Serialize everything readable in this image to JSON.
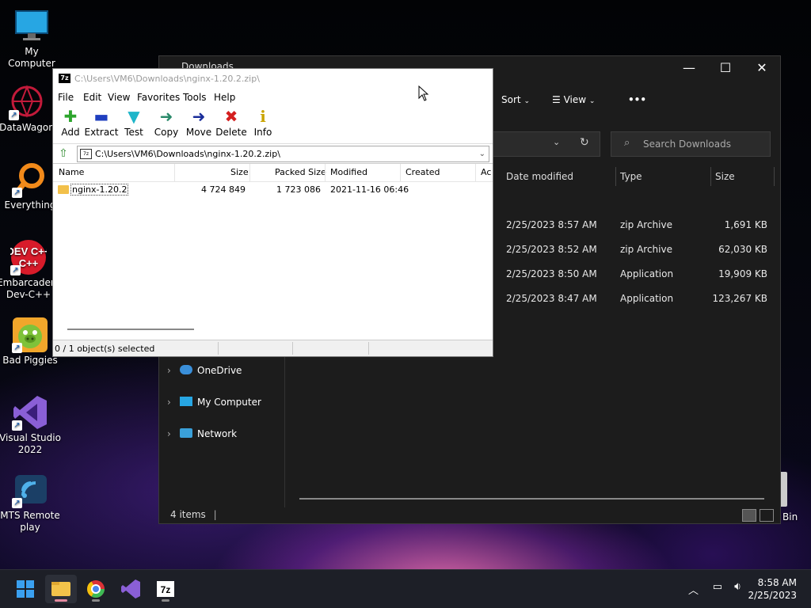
{
  "desktop": {
    "icons": [
      {
        "label": "My Computer",
        "icon": "monitor-icon"
      },
      {
        "label": "DataWagon",
        "icon": "datawagon-icon"
      },
      {
        "label": "Everything",
        "icon": "everything-icon"
      },
      {
        "label": "Embarcadero Dev-C++",
        "label1": "Embarcadero",
        "label2": "Dev-C++",
        "icon": "devcpp-icon",
        "logo_text": "DEV C++"
      },
      {
        "label": "Bad Piggies",
        "icon": "bad-piggies-icon"
      },
      {
        "label": "Visual Studio 2022",
        "label1": "Visual Studio",
        "label2": "2022",
        "icon": "visual-studio-icon"
      },
      {
        "label": "MTS Remote play",
        "label1": "MTS Remote",
        "label2": "play",
        "icon": "mts-remote-icon"
      }
    ],
    "recycle_bin_label_partial": "Bin"
  },
  "explorer": {
    "title": "Downloads",
    "toolbar": {
      "sort": "Sort",
      "view": "View",
      "more": "•••"
    },
    "search_placeholder": "Search Downloads",
    "columns": {
      "date_modified": "Date modified",
      "type": "Type",
      "size": "Size"
    },
    "files": [
      {
        "date": "2/25/2023 8:57 AM",
        "type": "zip Archive",
        "size": "1,691 KB"
      },
      {
        "date": "2/25/2023 8:52 AM",
        "type": "zip Archive",
        "size": "62,030 KB"
      },
      {
        "date": "2/25/2023 8:50 AM",
        "type": "Application",
        "size": "19,909 KB"
      },
      {
        "date": "2/25/2023 8:47 AM",
        "type": "Application",
        "size": "123,267 KB"
      }
    ],
    "nav": [
      {
        "label": "OneDrive",
        "icon": "cloud-icon"
      },
      {
        "label": "My Computer",
        "icon": "monitor-icon"
      },
      {
        "label": "Network",
        "icon": "network-icon"
      }
    ],
    "status": "4 items"
  },
  "sevenzip": {
    "title": "C:\\Users\\VM6\\Downloads\\nginx-1.20.2.zip\\",
    "logo": "7z",
    "menu": [
      "File",
      "Edit",
      "View",
      "Favorites",
      "Tools",
      "Help"
    ],
    "tools": [
      {
        "label": "Add",
        "glyph": "✚",
        "color": "#2da52d"
      },
      {
        "label": "Extract",
        "glyph": "▬",
        "color": "#1f3fbf"
      },
      {
        "label": "Test",
        "glyph": "▼",
        "color": "#1fb5c9"
      },
      {
        "label": "Copy",
        "glyph": "➜",
        "color": "#2a8a6a"
      },
      {
        "label": "Move",
        "glyph": "➜",
        "color": "#1a2d9a"
      },
      {
        "label": "Delete",
        "glyph": "✖",
        "color": "#d41f1f"
      },
      {
        "label": "Info",
        "glyph": "i",
        "color": "#c9a400"
      }
    ],
    "path": "C:\\Users\\VM6\\Downloads\\nginx-1.20.2.zip\\",
    "columns": {
      "name": "Name",
      "size": "Size",
      "packed": "Packed Size",
      "modified": "Modified",
      "created": "Created",
      "accessed": "Ac"
    },
    "rows": [
      {
        "name": "nginx-1.20.2",
        "size": "4 724 849",
        "packed": "1 723 086",
        "modified": "2021-11-16 06:46"
      }
    ],
    "status": "0 / 1 object(s) selected"
  },
  "taskbar": {
    "time": "8:58 AM",
    "date": "2/25/2023"
  }
}
